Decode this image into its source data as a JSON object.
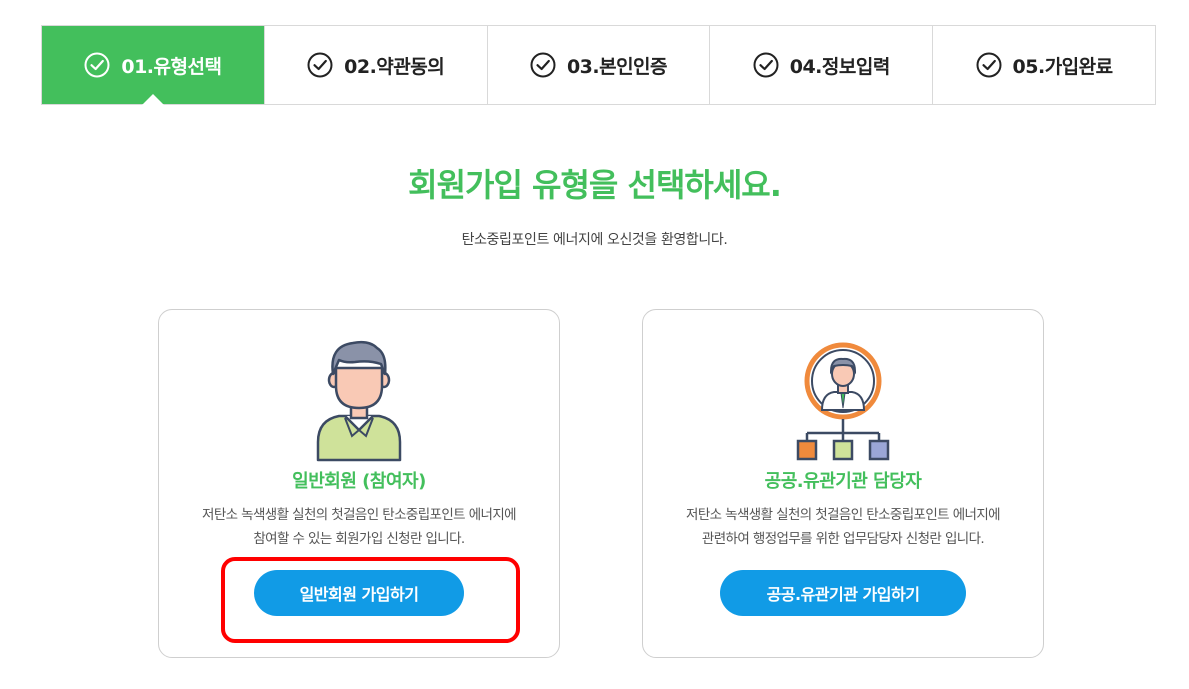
{
  "steps": [
    {
      "label": "01.유형선택",
      "active": true
    },
    {
      "label": "02.약관동의",
      "active": false
    },
    {
      "label": "03.본인인증",
      "active": false
    },
    {
      "label": "04.정보입력",
      "active": false
    },
    {
      "label": "05.가입완료",
      "active": false
    }
  ],
  "header": {
    "title": "회원가입 유형을 선택하세요.",
    "subtitle": "탄소중립포인트 에너지에 오신것을 환영합니다."
  },
  "cards": [
    {
      "icon": "person-icon",
      "title": "일반회원 (참여자)",
      "desc_line1": "저탄소 녹색생활 실천의 첫걸음인 탄소중립포인트 에너지에",
      "desc_line2": "참여할 수 있는 회원가입 신청란 입니다.",
      "button": "일반회원 가입하기"
    },
    {
      "icon": "org-chart-manager-icon",
      "title": "공공.유관기관 담당자",
      "desc_line1": "저탄소 녹색생활 실천의 첫걸음인 탄소중립포인트 에너지에",
      "desc_line2": "관련하여 행정업무를 위한 업무담당자 신청란 입니다.",
      "button": "공공.유관기관 가입하기"
    }
  ],
  "colors": {
    "accent_green": "#43bf5c",
    "button_blue": "#119be6",
    "highlight_red": "#ff0000"
  }
}
